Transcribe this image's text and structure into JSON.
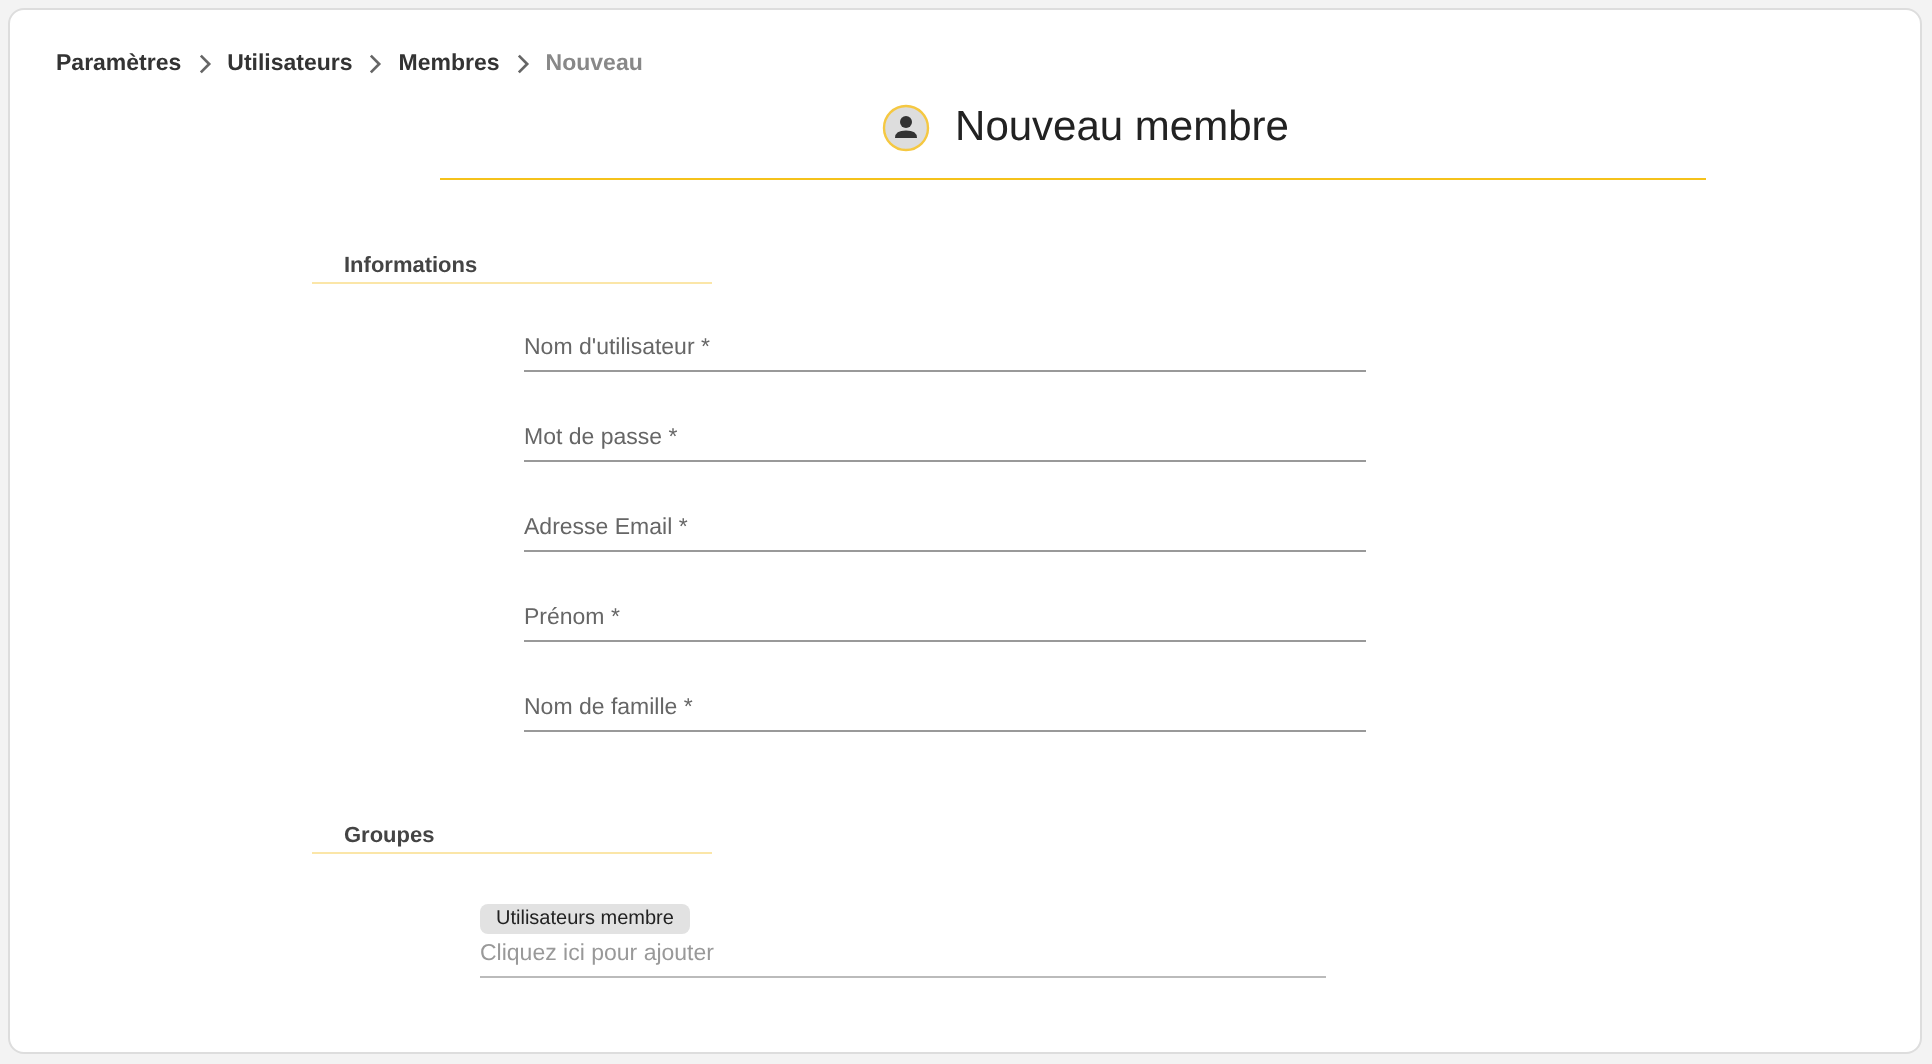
{
  "breadcrumb": [
    {
      "label": "Paramètres",
      "current": false
    },
    {
      "label": "Utilisateurs",
      "current": false
    },
    {
      "label": "Membres",
      "current": false
    },
    {
      "label": "Nouveau",
      "current": true
    }
  ],
  "title": "Nouveau membre",
  "sections": [
    {
      "heading": "Informations",
      "kind": "fields",
      "fields": [
        {
          "placeholder": "Nom d'utilisateur *"
        },
        {
          "placeholder": "Mot de passe *"
        },
        {
          "placeholder": "Adresse Email *"
        },
        {
          "placeholder": "Prénom *"
        },
        {
          "placeholder": "Nom de famille *"
        }
      ]
    },
    {
      "heading": "Groupes",
      "kind": "chips",
      "chips": [
        "Utilisateurs membre"
      ],
      "placeholder": "Cliquez ici pour ajouter"
    }
  ]
}
